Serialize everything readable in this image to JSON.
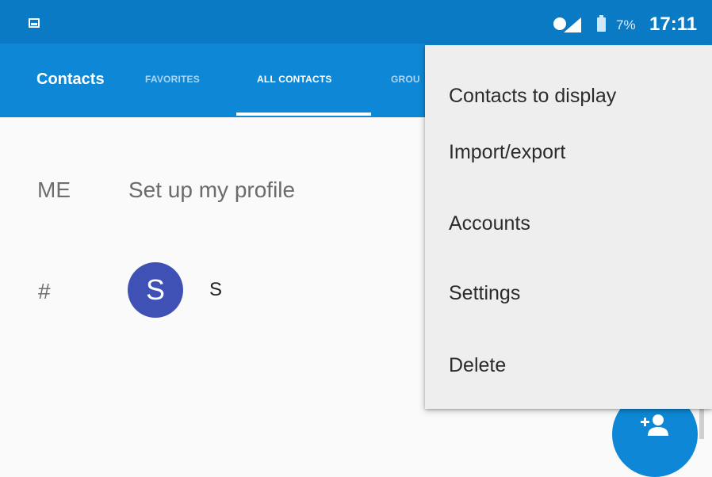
{
  "status_bar": {
    "battery_percent": "7%",
    "time": "17:11",
    "left_icon": "image-notification-icon",
    "signal_icon": "signal-icon",
    "battery_icon": "battery-icon"
  },
  "app_bar": {
    "title": "Contacts",
    "tabs": [
      {
        "label": "FAVORITES",
        "selected": false
      },
      {
        "label": "ALL CONTACTS",
        "selected": true
      },
      {
        "label": "GROU",
        "selected": false
      }
    ]
  },
  "list": {
    "me_label": "ME",
    "profile_text": "Set up my profile",
    "section_label": "#",
    "contacts": [
      {
        "avatar_letter": "S",
        "name": "S",
        "avatar_color": "#3f51b5"
      }
    ]
  },
  "overflow_menu": {
    "items": [
      "Contacts to display",
      "Import/export",
      "Accounts",
      "Settings",
      "Delete"
    ]
  },
  "fab": {
    "icon": "add-contact-icon"
  },
  "colors": {
    "status_bar": "#0b7ac4",
    "app_bar": "#0e88d6",
    "avatar": "#3f51b5",
    "menu_bg": "#eeeeee"
  }
}
